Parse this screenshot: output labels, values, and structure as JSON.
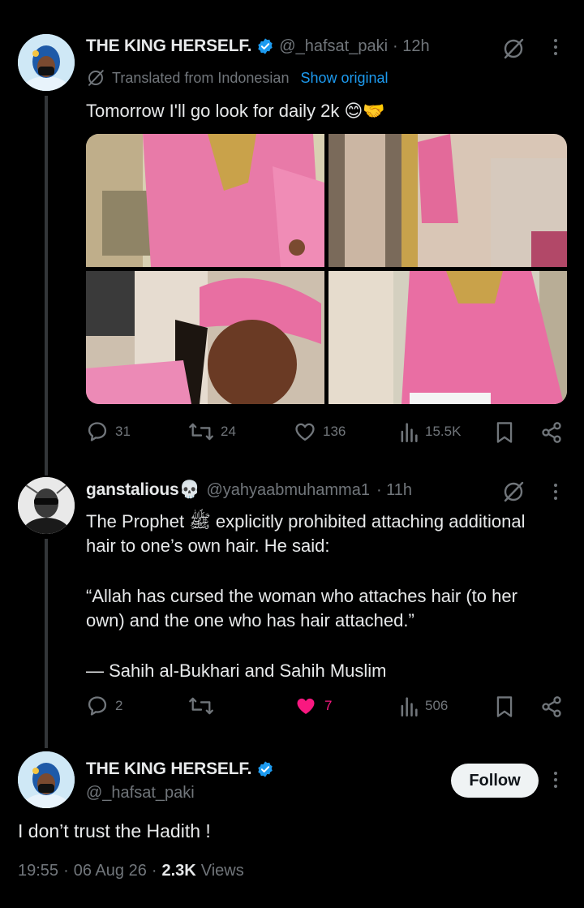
{
  "tweet1": {
    "name": "THE KING HERSELF.",
    "handle": "@_hafsat_paki",
    "time": "· 12h",
    "translated_label": "Translated from Indonesian",
    "show_original": "Show original",
    "text": "Tomorrow I'll go look for daily 2k 😊🤝",
    "replies": "31",
    "retweets": "24",
    "likes": "136",
    "views": "15.5K"
  },
  "tweet2": {
    "name": "ganstalious💀",
    "handle": "@yahyaabmuhamma1",
    "time": "· 11h",
    "text_line1": "The Prophet ﷺ explicitly prohibited attaching additional",
    "text_line2": "hair to one’s own hair. He said:",
    "quote_line1": "“Allah has cursed the woman who attaches hair (to her",
    "quote_line2": "own) and the one who has hair attached.”",
    "source": "— Sahih al-Bukhari and Sahih Muslim",
    "replies": "2",
    "likes": "7",
    "views": "506"
  },
  "tweet3": {
    "name": "THE KING HERSELF.",
    "handle": "@_hafsat_paki",
    "follow_label": "Follow",
    "text": "I don’t trust the Hadith !",
    "time": "19:55",
    "date": "06 Aug 26",
    "views_count": "2.3K",
    "views_label": "Views"
  },
  "colors": {
    "background": "#000000",
    "text": "#e7e9ea",
    "muted": "#71767b",
    "link": "#1d9bf0",
    "like_active": "#f91880"
  },
  "icons": [
    "grok-icon",
    "more-icon",
    "translate-icon",
    "reply-icon",
    "retweet-icon",
    "like-icon",
    "views-icon",
    "bookmark-icon",
    "share-icon",
    "verified-icon"
  ]
}
